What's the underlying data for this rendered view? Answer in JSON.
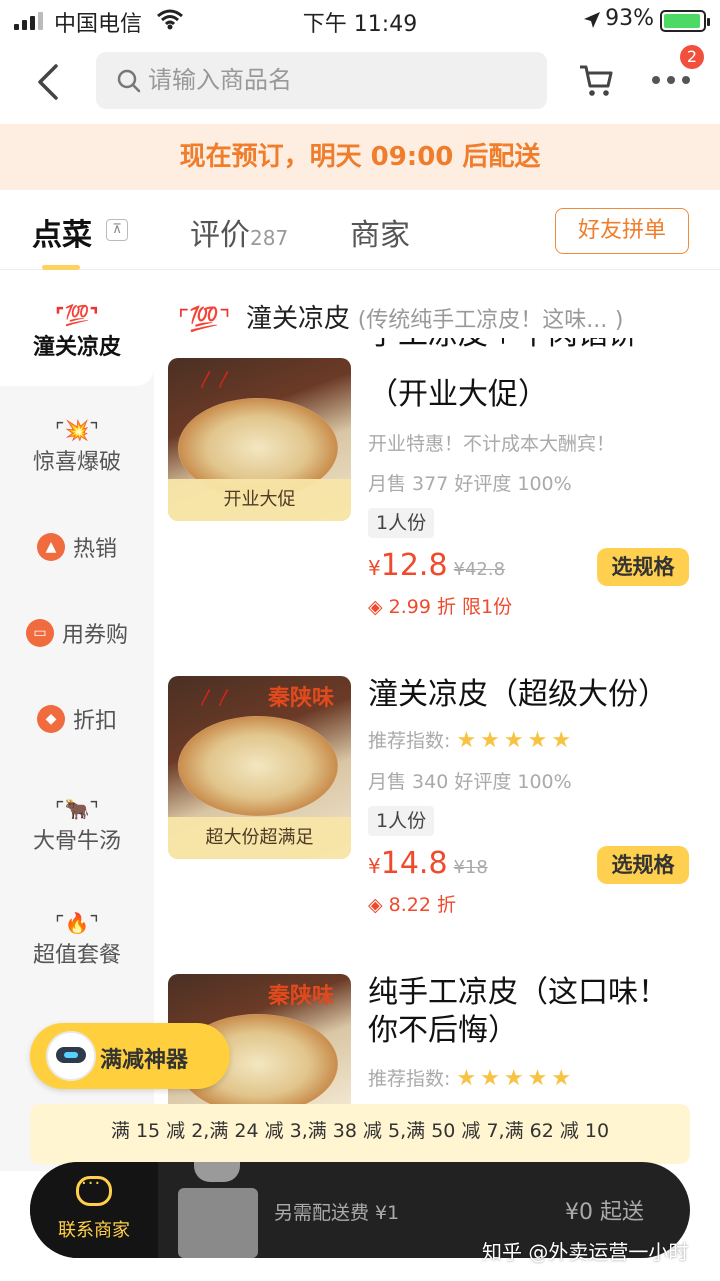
{
  "status_bar": {
    "carrier": "中国电信",
    "time": "下午 11:49",
    "battery": "93%"
  },
  "header": {
    "search_placeholder": "请输入商品名",
    "cart_badge": "2"
  },
  "banner": {
    "text": "现在预订，明天 09:00 后配送"
  },
  "tabs": {
    "order": "点菜",
    "review": "评价",
    "review_count": "287",
    "merchant": "商家",
    "group_button": "好友拼单"
  },
  "sidebar": {
    "items": [
      {
        "label": "潼关凉皮",
        "icon": "💯"
      },
      {
        "label": "惊喜爆破",
        "icon": "💥"
      },
      {
        "label": "热销",
        "icon": "flame-icon"
      },
      {
        "label": "用券购",
        "icon": "ticket-icon"
      },
      {
        "label": "折扣",
        "icon": "tag-icon"
      },
      {
        "label": "大骨牛汤",
        "icon": "🐂"
      },
      {
        "label": "超值套餐",
        "icon": "🔥"
      }
    ]
  },
  "category": {
    "title": "潼关凉皮",
    "description": "(传统纯手工凉皮！这味...",
    "close": ")"
  },
  "products": [
    {
      "name_line1": "手工凉皮＋牛肉馅饼",
      "name_line2": "（开业大促）",
      "image_tag": "开业大促",
      "tagline": "开业特惠！不计成本大酬宾！",
      "stats": "月售 377  好评度 100%",
      "portion": "1人份",
      "price": "12.8",
      "original_price": "¥42.8",
      "discount": "2.99 折 限1份",
      "button": "选规格"
    },
    {
      "name_line1": "潼关凉皮（超级大份）",
      "image_tag": "超大份超满足",
      "recommend_label": "推荐指数:",
      "stars": 5,
      "stats": "月售 340  好评度 100%",
      "portion": "1人份",
      "price": "14.8",
      "original_price": "¥18",
      "discount": "8.22 折",
      "button": "选规格"
    },
    {
      "name_line1": "纯手工凉皮（这口味！",
      "name_line2": "你不后悔）",
      "recommend_label": "推荐指数:",
      "stars": 5
    }
  ],
  "promo": {
    "bot_label": "满减神器",
    "strip": "满 15 减 2,满 24 减 3,满 38 减 5,满 50 减 7,满 62 减 10"
  },
  "bottom_bar": {
    "contact": "联系商家",
    "delivery_fee": "另需配送费 ¥1",
    "min_order": "¥0 起送"
  },
  "watermark": "知乎 @外卖运营一小时",
  "brand_text": "秦陕味",
  "colors": {
    "accent_orange": "#f07d2b",
    "price_red": "#ef4a2c",
    "button_yellow": "#ffcf4f",
    "banner_bg": "#fdeee1"
  }
}
